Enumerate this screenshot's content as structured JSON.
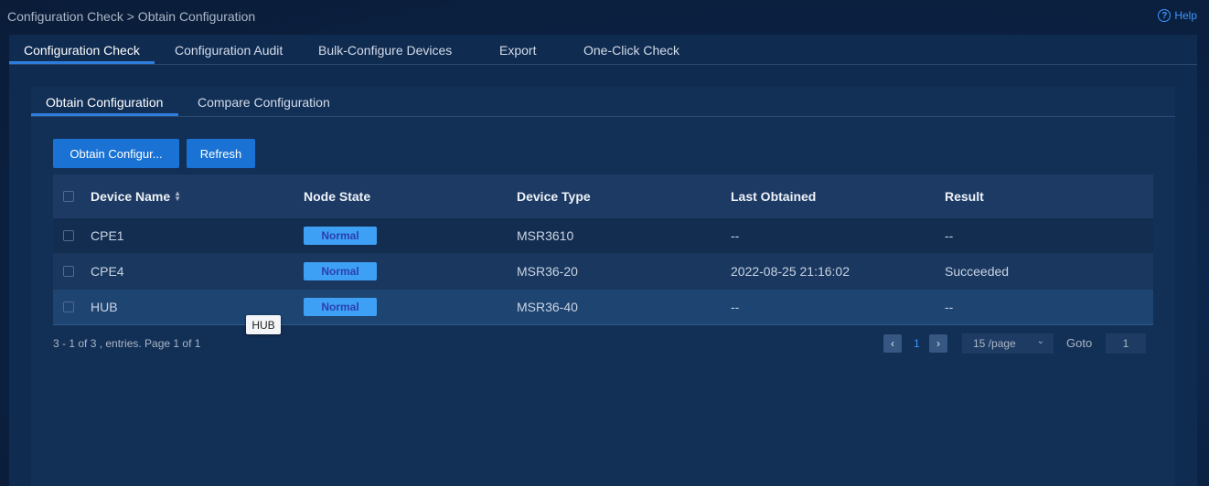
{
  "breadcrumb": "Configuration Check > Obtain Configuration",
  "help": {
    "icon": "?",
    "label": "Help"
  },
  "main_tabs": [
    "Configuration Check",
    "Configuration Audit",
    "Bulk-Configure Devices",
    "Export",
    "One-Click Check"
  ],
  "sub_tabs": [
    "Obtain Configuration",
    "Compare Configuration"
  ],
  "buttons": {
    "obtain": "Obtain Configur...",
    "refresh": "Refresh"
  },
  "table": {
    "columns": [
      "Device Name",
      "Node State",
      "Device Type",
      "Last Obtained",
      "Result"
    ],
    "rows": [
      {
        "name": "CPE1",
        "state": "Normal",
        "type": "MSR3610",
        "last": "--",
        "result": "--"
      },
      {
        "name": "CPE4",
        "state": "Normal",
        "type": "MSR36-20",
        "last": "2022-08-25 21:16:02",
        "result": "Succeeded"
      },
      {
        "name": "HUB",
        "state": "Normal",
        "type": "MSR36-40",
        "last": "--",
        "result": "--"
      }
    ]
  },
  "tooltip": "HUB",
  "pagination": {
    "info": "3 - 1 of 3 , entries. Page 1 of 1",
    "prev": "‹",
    "page": "1",
    "next": "›",
    "size": "15 /page",
    "size_chevron": "⌄",
    "goto_label": "Goto",
    "goto_value": "1"
  },
  "colors": {
    "accent": "#1a73d4",
    "badge": "#3ea0f5",
    "link": "#3a97ff"
  }
}
